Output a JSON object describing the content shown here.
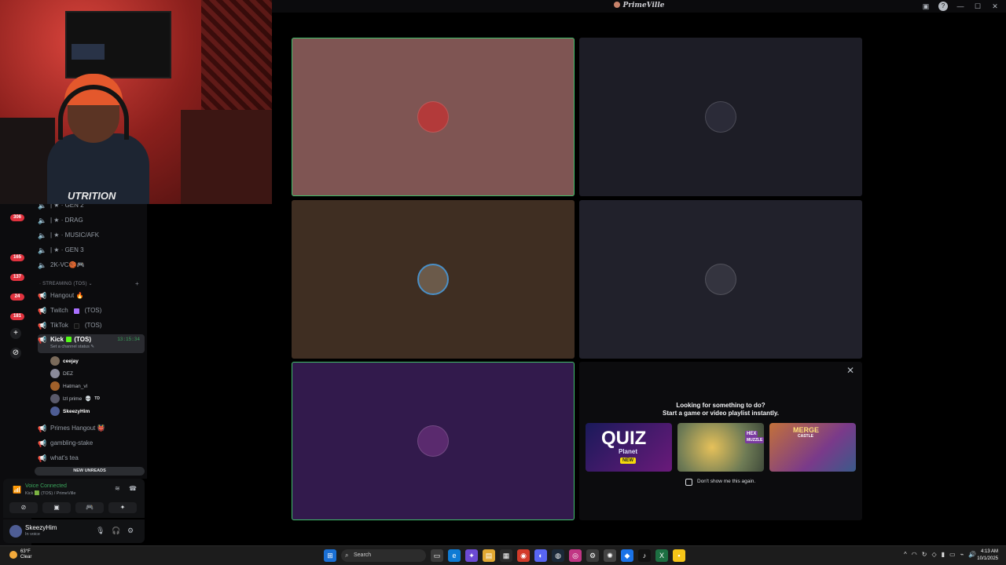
{
  "window": {
    "title": "PrimeVille"
  },
  "webcam": {
    "shirt_text": "UTRITION"
  },
  "servers": [
    {
      "badge": "306",
      "color": "#3f4a6b"
    },
    {
      "badge": "",
      "color": "#5865f2"
    },
    {
      "badge": "165",
      "color": "#2c6fb5"
    },
    {
      "badge": "137",
      "color": "#4a6b3a"
    },
    {
      "badge": "24",
      "color": "#6b3a2a"
    },
    {
      "badge": "181",
      "color": "#2a4f8c"
    }
  ],
  "channels": {
    "voice_top": [
      {
        "label": "| ★ · GEN 2"
      },
      {
        "label": "| ★ · DRAG"
      },
      {
        "label": "| ★ · MUSIC/AFK"
      },
      {
        "label": "| ★ · GEN 3"
      },
      {
        "label": "2K-VC🏀🎮"
      }
    ],
    "streaming_category": "STREAMING (TOS)",
    "streaming": [
      {
        "label": "Hangout 🔥"
      },
      {
        "label": "Twitch",
        "suffix": "(TOS)",
        "square_color": "#a970ff"
      },
      {
        "label": "TikTok",
        "suffix": "(TOS)",
        "square_color": "#111111"
      }
    ],
    "active": {
      "label": "Kick",
      "suffix": "(TOS)",
      "square_color": "#53fc18",
      "timer": "13:15:34",
      "status_placeholder": "Set a channel status ✎"
    },
    "members": [
      {
        "name": "ceejay",
        "bold": true,
        "color": "#7a6a5a"
      },
      {
        "name": "DEZ",
        "bold": false,
        "color": "#8a8a9a"
      },
      {
        "name": "Hatman_vl",
        "bold": false,
        "color": "#a0602a"
      },
      {
        "name": "lzl prime",
        "bold": false,
        "tag": "TD",
        "color": "#5a5a6a"
      },
      {
        "name": "SkeezyHim",
        "bold": true,
        "color": "#4e5d94"
      }
    ],
    "after": [
      {
        "label": "Primes Hangout 👹"
      },
      {
        "label": "gambling-stake"
      },
      {
        "label": "what's tea"
      }
    ],
    "new_unreads": "NEW UNREADS"
  },
  "voice": {
    "status": "Voice Connected",
    "location": "Kick 🟩 (TOS) / PrimeVille"
  },
  "user": {
    "name": "SkeezyHim",
    "status": "In voice"
  },
  "tiles": [
    {
      "name": "tile-ceejay",
      "bg": "#7f5553",
      "avatar": "#b33a3a",
      "speaking": true
    },
    {
      "name": "tile-dez",
      "bg": "#1d1d26",
      "avatar": "#2b2b38",
      "speaking": false
    },
    {
      "name": "tile-hatman",
      "bg": "#3f2e22",
      "avatar": "#6b5a4a",
      "speaking": false
    },
    {
      "name": "tile-lzl-prime",
      "bg": "#21212b",
      "avatar": "#34343f",
      "speaking": false
    },
    {
      "name": "tile-skeezyhim",
      "bg": "#321a4c",
      "avatar": "#5a2a6e",
      "speaking": true
    }
  ],
  "activity": {
    "line1": "Looking for something to do?",
    "line2": "Start a game or video playlist instantly.",
    "games": [
      {
        "title": "QUIZ",
        "sub": "Planet",
        "tag": "NEW"
      },
      {
        "title": "HEX",
        "sub": "MUZZLE"
      },
      {
        "title": "MERGE",
        "sub": "CASTLE"
      }
    ],
    "dont_show": "Don't show me this again."
  },
  "taskbar": {
    "weather_temp": "63°F",
    "weather_cond": "Clear",
    "search": "Search",
    "time": "4:13 AM",
    "date": "10/1/2025"
  }
}
